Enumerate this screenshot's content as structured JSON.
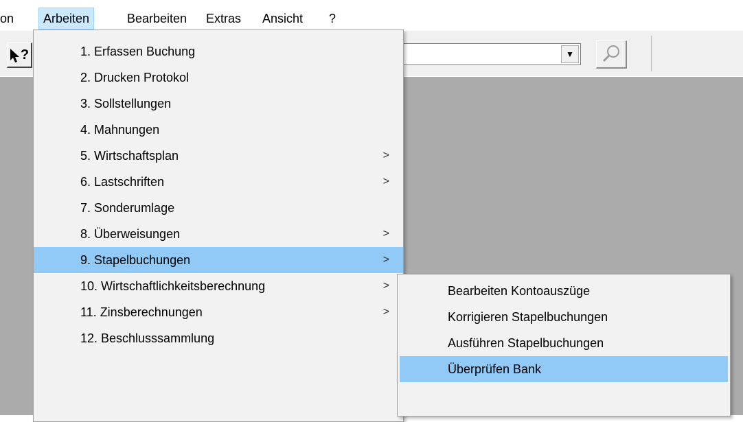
{
  "menubar": [
    {
      "label": "on",
      "open": false
    },
    {
      "label": "Arbeiten",
      "open": true
    },
    {
      "label": "Bearbeiten",
      "open": false
    },
    {
      "label": "Extras",
      "open": false
    },
    {
      "label": "Ansicht",
      "open": false
    },
    {
      "label": "?",
      "open": false
    }
  ],
  "toolbar": {
    "help_glyph": "?",
    "combo_value": "",
    "combo_arrow": "▼"
  },
  "arbeiten_menu": [
    {
      "label": "1. Erfassen Buchung",
      "submenu": false,
      "highlighted": false
    },
    {
      "label": "2. Drucken Protokol",
      "submenu": false,
      "highlighted": false
    },
    {
      "label": "3. Sollstellungen",
      "submenu": false,
      "highlighted": false
    },
    {
      "label": "4. Mahnungen",
      "submenu": false,
      "highlighted": false
    },
    {
      "label": "5. Wirtschaftsplan",
      "submenu": true,
      "highlighted": false
    },
    {
      "label": "6. Lastschriften",
      "submenu": true,
      "highlighted": false
    },
    {
      "label": "7. Sonderumlage",
      "submenu": false,
      "highlighted": false
    },
    {
      "label": "8. Überweisungen",
      "submenu": true,
      "highlighted": false
    },
    {
      "label": "9. Stapelbuchungen",
      "submenu": true,
      "highlighted": true
    },
    {
      "label": "10. Wirtschaftlichkeitsberechnung",
      "submenu": true,
      "highlighted": false
    },
    {
      "label": "11. Zinsberechnungen",
      "submenu": true,
      "highlighted": false
    },
    {
      "label": "12. Beschlusssammlung",
      "submenu": false,
      "highlighted": false
    }
  ],
  "submenu_arrow": ">",
  "stapel_submenu": [
    {
      "label": "Bearbeiten Kontoauszüge",
      "highlighted": false
    },
    {
      "label": "Korrigieren Stapelbuchungen",
      "highlighted": false
    },
    {
      "label": "Ausführen Stapelbuchungen",
      "highlighted": false
    },
    {
      "label": "Überprüfen Bank",
      "highlighted": true
    }
  ],
  "colors": {
    "menu_highlight": "#91c9f7",
    "menubar_open": "#cce8ff",
    "workspace": "#ababab"
  }
}
